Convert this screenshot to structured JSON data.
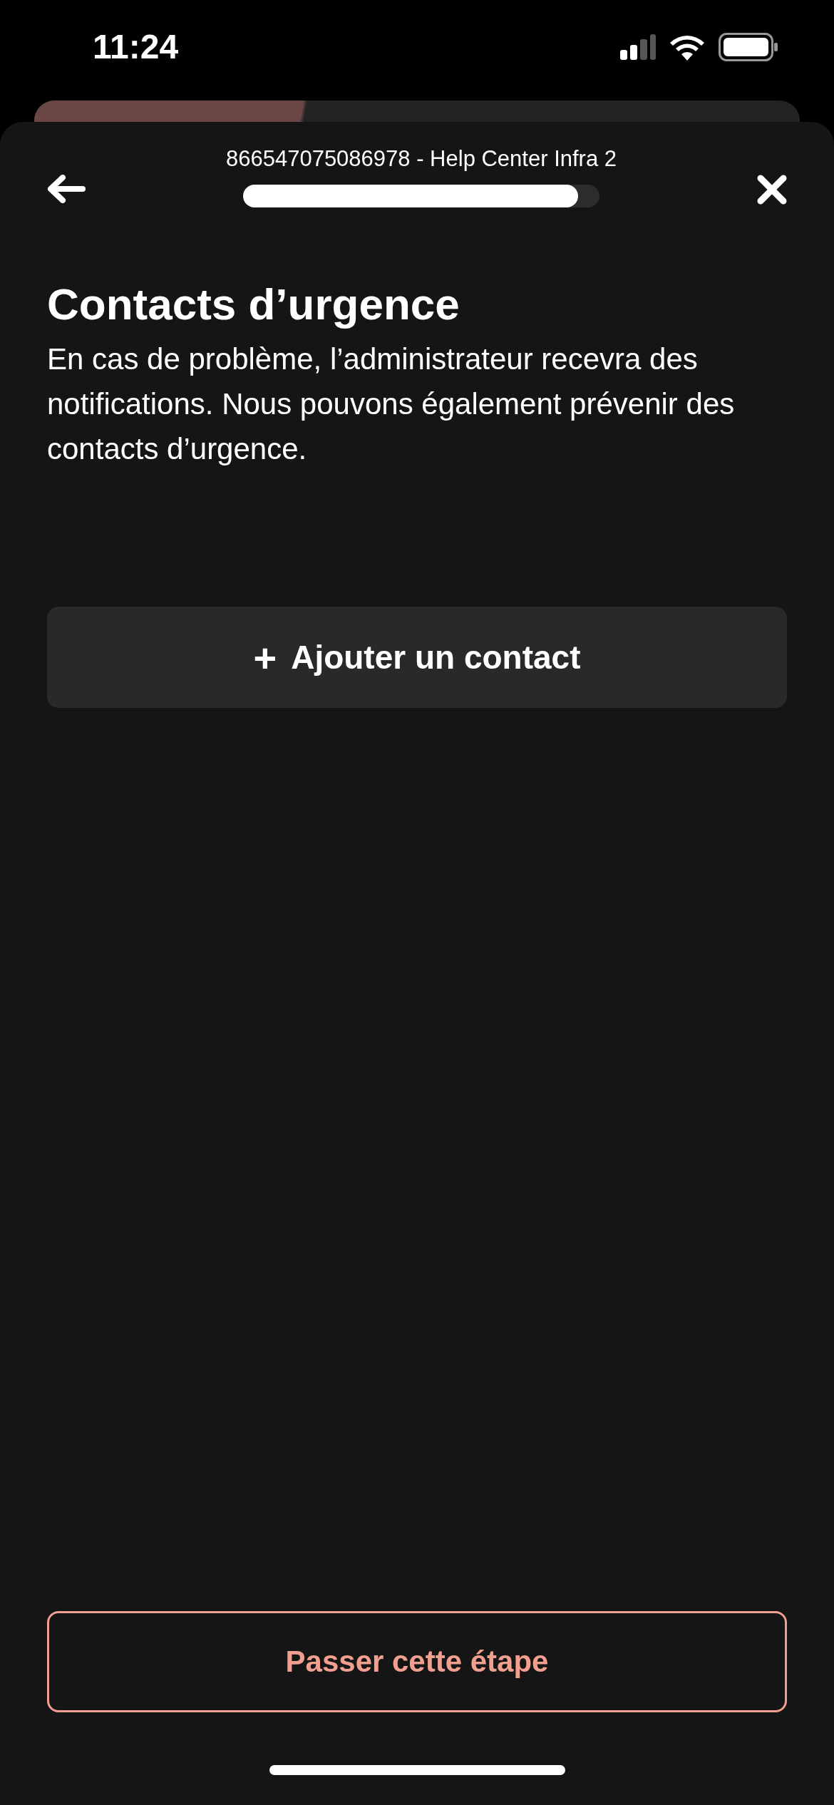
{
  "status_bar": {
    "time": "11:24"
  },
  "header": {
    "title": "866547075086978 - Help Center Infra 2",
    "progress": {
      "level": 0.94
    }
  },
  "heading": "Contacts d’urgence",
  "description": "En cas de problème, l’administrateur recevra des notifications. Nous pouvons également prévenir des contacts d’urgence.",
  "add_button": {
    "icon": "+",
    "label": "Ajouter un contact"
  },
  "skip_button": {
    "label": "Passer cette étape"
  }
}
